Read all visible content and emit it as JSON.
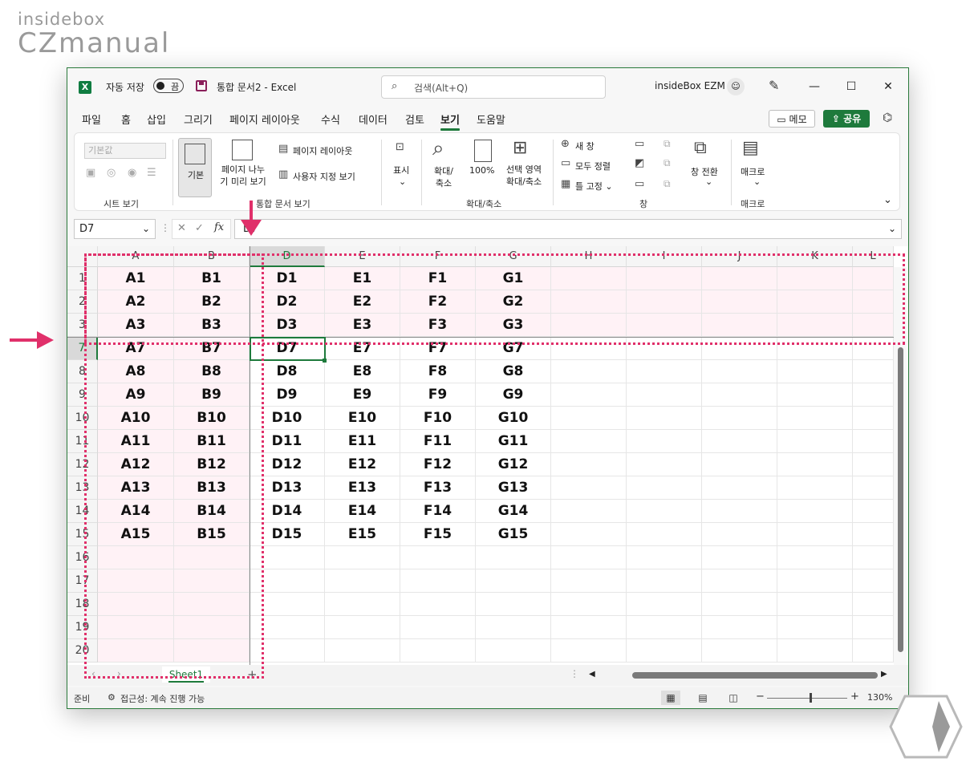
{
  "brand": {
    "line1": "insidebox",
    "line2": "CZmanual"
  },
  "titlebar": {
    "autosave_label": "자동 저장",
    "autosave_state": "끔",
    "doc_title": "통합 문서2  -  Excel",
    "search_placeholder": "검색(Alt+Q)",
    "user_name": "insideBox EZM",
    "minimize": "—",
    "maximize": "☐",
    "close": "✕"
  },
  "tabs": [
    "파일",
    "홈",
    "삽입",
    "그리기",
    "페이지 레이아웃",
    "수식",
    "데이터",
    "검토",
    "보기",
    "도움말"
  ],
  "active_tab": "보기",
  "actions": {
    "memo": "메모",
    "share": "공유"
  },
  "ribbon": {
    "sheet_view": {
      "combo": "기본값",
      "group": "시트 보기"
    },
    "workbook_views": {
      "normal": "기본",
      "page_break_l1": "페이지 나누",
      "page_break_l2": "기 미리 보기",
      "page_layout": "페이지 레이아웃",
      "custom_view": "사용자 지정 보기",
      "group": "통합 문서 보기"
    },
    "show": {
      "label": "표시"
    },
    "zoom": {
      "zoom_l1": "확대/",
      "zoom_l2": "축소",
      "hundred": "100%",
      "selection_l1": "선택 영역",
      "selection_l2": "확대/축소",
      "group": "확대/축소"
    },
    "window": {
      "new_window": "새 창",
      "arrange_all": "모두 정렬",
      "freeze": "틀 고정",
      "switch": "창 전환",
      "group": "창"
    },
    "macros": {
      "label": "매크로",
      "group": "매크로"
    }
  },
  "formula_bar": {
    "name_box": "D7",
    "value": "D7",
    "fx": "fx"
  },
  "grid": {
    "columns": [
      "A",
      "B",
      "D",
      "E",
      "F",
      "G",
      "H",
      "I",
      "J",
      "K",
      "L"
    ],
    "rows": [
      {
        "num": "1",
        "cells": [
          "A1",
          "B1",
          "D1",
          "E1",
          "F1",
          "G1"
        ]
      },
      {
        "num": "2",
        "cells": [
          "A2",
          "B2",
          "D2",
          "E2",
          "F2",
          "G2"
        ]
      },
      {
        "num": "3",
        "cells": [
          "A3",
          "B3",
          "D3",
          "E3",
          "F3",
          "G3"
        ]
      },
      {
        "num": "7",
        "cells": [
          "A7",
          "B7",
          "D7",
          "E7",
          "F7",
          "G7"
        ]
      },
      {
        "num": "8",
        "cells": [
          "A8",
          "B8",
          "D8",
          "E8",
          "F8",
          "G8"
        ]
      },
      {
        "num": "9",
        "cells": [
          "A9",
          "B9",
          "D9",
          "E9",
          "F9",
          "G9"
        ]
      },
      {
        "num": "10",
        "cells": [
          "A10",
          "B10",
          "D10",
          "E10",
          "F10",
          "G10"
        ]
      },
      {
        "num": "11",
        "cells": [
          "A11",
          "B11",
          "D11",
          "E11",
          "F11",
          "G11"
        ]
      },
      {
        "num": "12",
        "cells": [
          "A12",
          "B12",
          "D12",
          "E12",
          "F12",
          "G12"
        ]
      },
      {
        "num": "13",
        "cells": [
          "A13",
          "B13",
          "D13",
          "E13",
          "F13",
          "G13"
        ]
      },
      {
        "num": "14",
        "cells": [
          "A14",
          "B14",
          "D14",
          "E14",
          "F14",
          "G14"
        ]
      },
      {
        "num": "15",
        "cells": [
          "A15",
          "B15",
          "D15",
          "E15",
          "F15",
          "G15"
        ]
      },
      {
        "num": "16",
        "cells": []
      },
      {
        "num": "17",
        "cells": []
      },
      {
        "num": "18",
        "cells": []
      },
      {
        "num": "19",
        "cells": []
      },
      {
        "num": "20",
        "cells": []
      }
    ]
  },
  "sheets": [
    "Sheet1"
  ],
  "status": {
    "ready": "준비",
    "accessibility": "접근성: 계속 진행 가능",
    "zoom": "130%",
    "minus": "−",
    "plus": "+"
  },
  "colors": {
    "accent": "#1e7a3c",
    "annotation": "#e0306a",
    "frozen_tint": "#fff2f6"
  }
}
